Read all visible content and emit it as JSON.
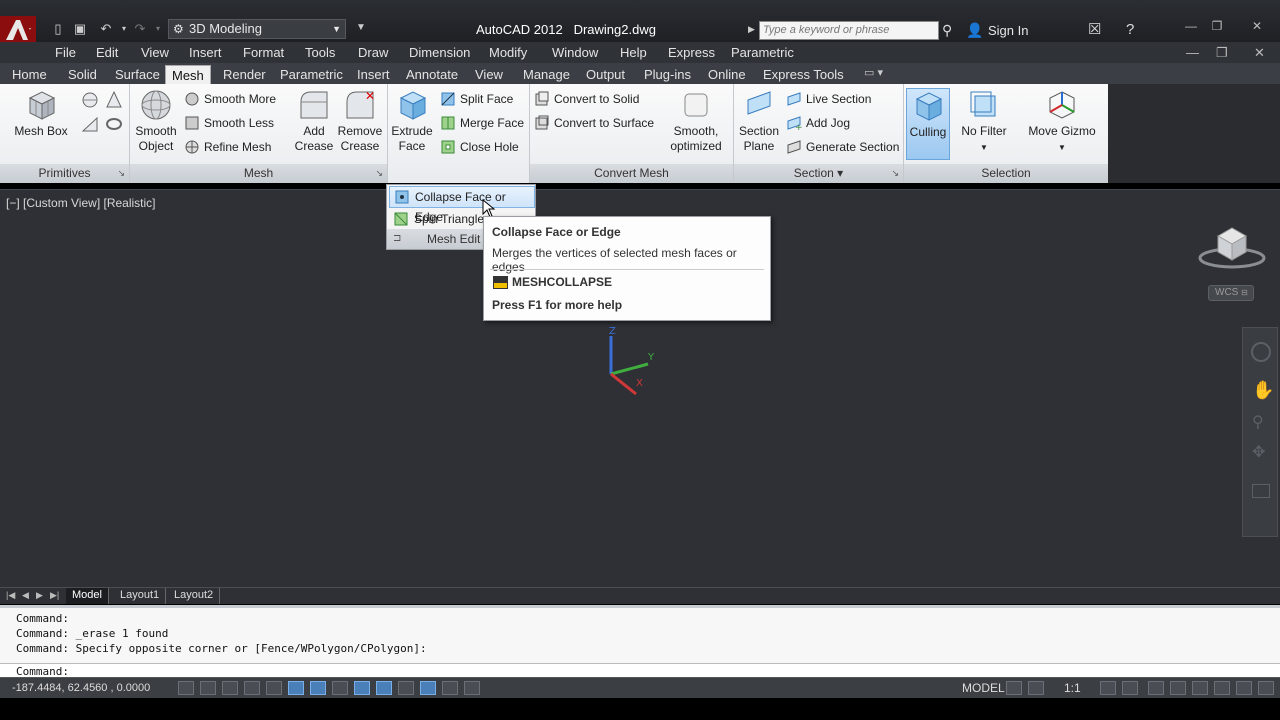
{
  "title_bar": {
    "workspace": "3D Modeling",
    "app_name": "AutoCAD 2012",
    "document": "Drawing2.dwg",
    "search_placeholder": "Type a keyword or phrase",
    "sign_in": "Sign In"
  },
  "menu": [
    "File",
    "Edit",
    "View",
    "Insert",
    "Format",
    "Tools",
    "Draw",
    "Dimension",
    "Modify",
    "Window",
    "Help",
    "Express",
    "Parametric"
  ],
  "tabs": [
    "Home",
    "Solid",
    "Surface",
    "Mesh",
    "Render",
    "Parametric",
    "Insert",
    "Annotate",
    "View",
    "Manage",
    "Output",
    "Plug-ins",
    "Online",
    "Express Tools"
  ],
  "active_tab": "Mesh",
  "ribbon": {
    "primitives": {
      "title": "Primitives",
      "mesh_box": "Mesh Box"
    },
    "mesh": {
      "title": "Mesh",
      "smooth_object": "Smooth Object",
      "smooth_more": "Smooth More",
      "smooth_less": "Smooth Less",
      "refine_mesh": "Refine Mesh",
      "add_crease": "Add Crease",
      "remove_crease": "Remove Crease"
    },
    "mesh_edit": {
      "extrude_face": "Extrude Face",
      "split_face": "Split Face",
      "merge_face": "Merge Face",
      "close_hole": "Close Hole"
    },
    "convert_mesh": {
      "title": "Convert Mesh",
      "convert_to_solid": "Convert to Solid",
      "convert_to_surface": "Convert to Surface",
      "smooth_optimized": "Smooth, optimized"
    },
    "section": {
      "title": "Section",
      "section_plane": "Section Plane",
      "live_section": "Live Section",
      "add_jog": "Add Jog",
      "generate_section": "Generate Section"
    },
    "selection": {
      "title": "Selection",
      "culling": "Culling",
      "no_filter": "No Filter",
      "move_gizmo": "Move Gizmo"
    }
  },
  "dropdown": {
    "items": [
      "Collapse Face or Edge",
      "Spin Triangle"
    ],
    "footer": "Mesh Edit"
  },
  "tooltip": {
    "title": "Collapse Face or Edge",
    "description": "Merges the vertices of selected mesh faces or edges",
    "command": "MESHCOLLAPSE",
    "help": "Press F1 for more help"
  },
  "viewport": {
    "label": "[−] [Custom View] [Realistic]",
    "wcs": "WCS",
    "ucs_z": "Z",
    "ucs_y": "Y",
    "ucs_x": "X"
  },
  "layout_tabs": [
    "Model",
    "Layout1",
    "Layout2"
  ],
  "command_history": [
    "Command:",
    "Command: _erase 1 found",
    "Command: Specify opposite corner or [Fence/WPolygon/CPolygon]:"
  ],
  "command_prompt": "Command:",
  "status": {
    "coordinates": "-187.4484, 62.4560 , 0.0000",
    "model": "MODEL",
    "scale": "1:1"
  },
  "colors": {
    "viewport_bg": "#2e3035",
    "ribbon_bg": "#f0f2f4",
    "brand_red": "#8b0d0d",
    "highlight": "#9cc8f0"
  }
}
